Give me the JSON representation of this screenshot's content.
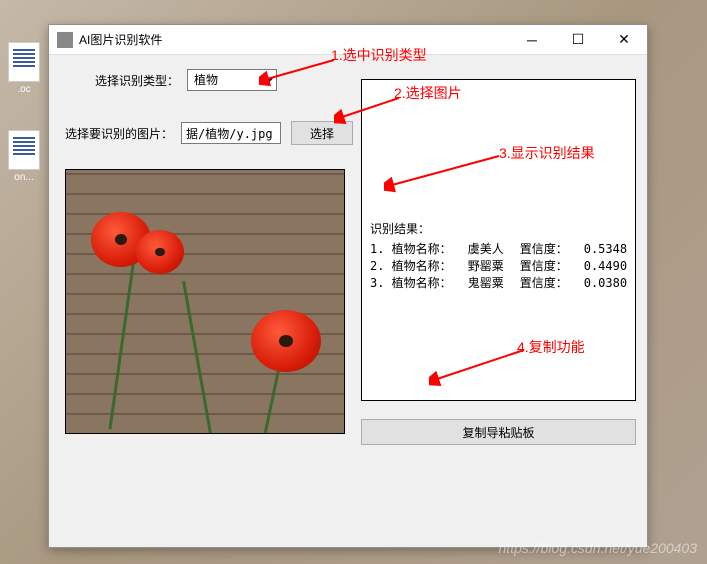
{
  "desktop": {
    "icon1_label": ".oc",
    "icon2_label": "on..."
  },
  "window": {
    "title": "AI图片识别软件"
  },
  "form": {
    "type_label": "选择识别类型：",
    "type_value": "植物",
    "path_label": "选择要识别的图片：",
    "path_value": "据/植物/y.jpg",
    "select_btn": "选择"
  },
  "results": {
    "header": "识别结果：",
    "rows": [
      {
        "idx": "1.",
        "name_label": "植物名称：",
        "name": "虞美人",
        "conf_label": "置信度：",
        "conf": "0.5348"
      },
      {
        "idx": "2.",
        "name_label": "植物名称：",
        "name": "野罂粟",
        "conf_label": "置信度：",
        "conf": "0.4490"
      },
      {
        "idx": "3.",
        "name_label": "植物名称：",
        "name": "鬼罂粟",
        "conf_label": "置信度：",
        "conf": "0.0380"
      }
    ],
    "copy_btn": "复制导粘贴板"
  },
  "annotations": {
    "a1": "1.选中识别类型",
    "a2": "2.选择图片",
    "a3": "3.显示识别结果",
    "a4": "4.复制功能"
  },
  "watermark": "https://blog.csdn.net/yue200403"
}
